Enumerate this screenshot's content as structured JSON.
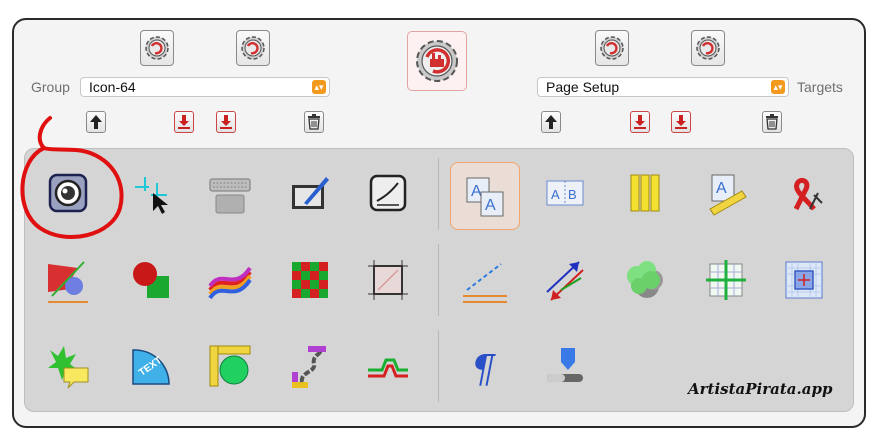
{
  "group": {
    "label": "Group",
    "value": "Icon-64"
  },
  "targets": {
    "label": "Targets",
    "value": "Page Setup"
  },
  "toolbar_icons": {
    "gear": "gear-icon",
    "main_gear": "app-gear-icon",
    "up": "arrow-up-icon",
    "download": "download-icon",
    "trash": "trash-icon"
  },
  "tools_left": [
    [
      "lens-icon",
      "crosshair-cursor-icon",
      "keyboard-icon",
      "tablet-pen-icon",
      "signature-pad-icon"
    ],
    [
      "stroke-flag-icon",
      "shape-combine-icon",
      "rainbow-icon",
      "checker-pattern-icon",
      "crop-frame-icon"
    ],
    [
      "speech-star-icon",
      "text-on-arc-icon",
      "ruler-circle-icon",
      "chain-link-icon",
      "step-path-icon"
    ]
  ],
  "tools_right": [
    [
      "text-duplicate-icon",
      "text-ab-icon",
      "rulers-icon",
      "text-ruler-icon",
      "ribbon-cut-icon"
    ],
    [
      "dashed-line-icon",
      "double-arrow-icon",
      "blob-shadow-icon",
      "grid-cross-icon",
      "grid-target-icon"
    ],
    [
      "paragraph-icon",
      "slider-pin-icon"
    ]
  ],
  "selected_tool": "text-duplicate-icon",
  "colors": {
    "accent": "#f39a1e",
    "gear_red": "#d23030",
    "annotation": "#e01010"
  },
  "brand_text": "ArtistaPirata.app"
}
